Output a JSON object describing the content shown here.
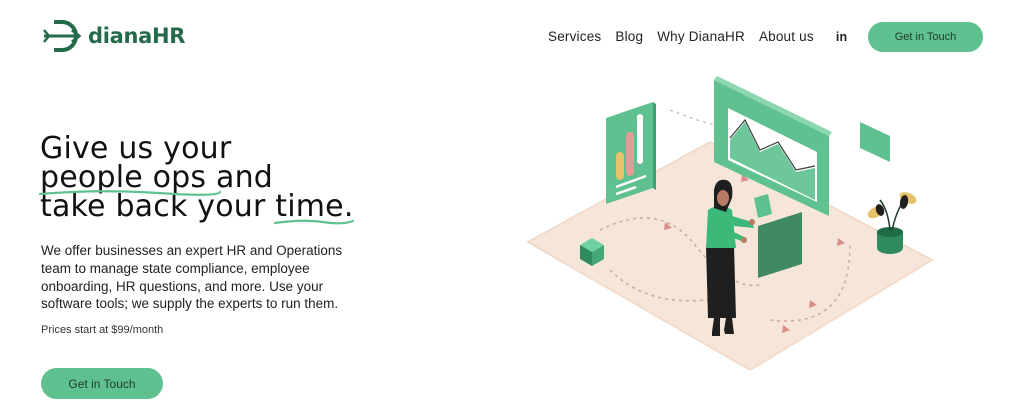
{
  "brand": {
    "name": "dianaHR",
    "color": "#236b4a",
    "logo_icon": "arrow-d-logo-icon"
  },
  "nav": {
    "items": [
      "Services",
      "Blog",
      "Why DianaHR",
      "About us"
    ],
    "social": "in",
    "cta": "Get in Touch"
  },
  "hero": {
    "headline_line1": "Give us your",
    "headline_underlined_1": "people ops",
    "headline_line2_rest": " and",
    "headline_line3_start": "take back your ",
    "headline_underlined_2": "time.",
    "description": "We offer businesses an expert HR and Operations team to manage state compliance, employee onboarding, HR questions, and more. Use your software tools; we supply the experts to run them.",
    "price": "Prices start at $99/month",
    "cta": "Get in Touch"
  },
  "colors": {
    "accent": "#5ec18f",
    "floor": "#f6e6da",
    "dark_green": "#2f8a5d"
  }
}
